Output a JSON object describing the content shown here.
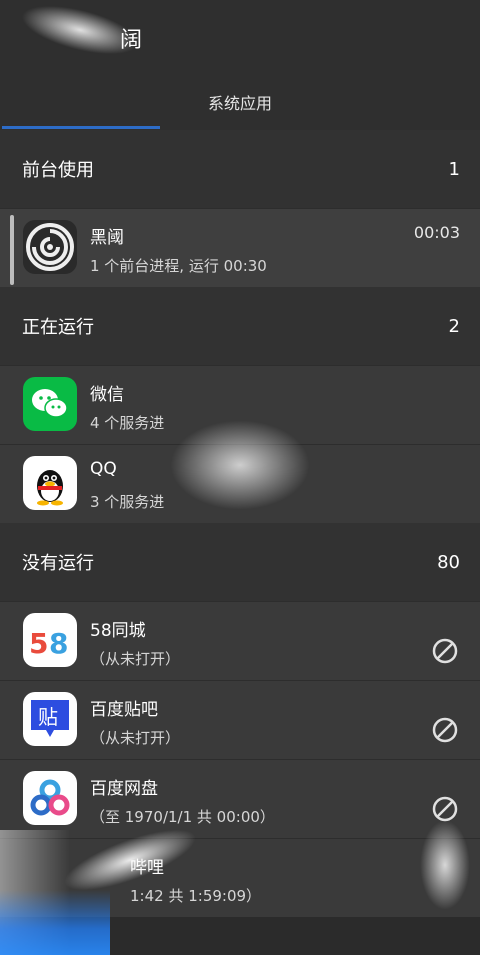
{
  "header": {
    "title_fragment": "阔"
  },
  "tabs": [
    {
      "label": "系统应用",
      "active": true
    }
  ],
  "sections": {
    "foreground": {
      "label": "前台使用",
      "count": "1"
    },
    "running": {
      "label": "正在运行",
      "count": "2"
    },
    "not_running": {
      "label": "没有运行",
      "count": "80"
    }
  },
  "apps": {
    "heiyue": {
      "name": "黑阈",
      "sub": "1 个前台进程, 运行 00:30",
      "time": "00:03",
      "icon": "heiyue-swirl-icon"
    },
    "wechat": {
      "name": "微信",
      "sub": "4 个服务进",
      "icon": "wechat-icon"
    },
    "qq": {
      "name": "QQ",
      "sub": "3 个服务进",
      "icon": "qq-penguin-icon"
    },
    "app58": {
      "name": "58同城",
      "sub": "（从未打开）",
      "icon": "58-icon"
    },
    "tieba": {
      "name": "百度贴吧",
      "sub": "（从未打开）",
      "icon": "tieba-icon",
      "icon_text": "贴"
    },
    "pan": {
      "name": "百度网盘",
      "sub": "（至 1970/1/1 共 00:00）",
      "icon": "baidu-pan-icon"
    },
    "bili": {
      "name": "哔哩",
      "sub": "1:42 共 1:59:09）",
      "icon": "bilibili-icon"
    }
  },
  "colors": {
    "accent": "#2d6cc7",
    "wechat": "#09bb45",
    "tieba": "#2d4de0"
  }
}
